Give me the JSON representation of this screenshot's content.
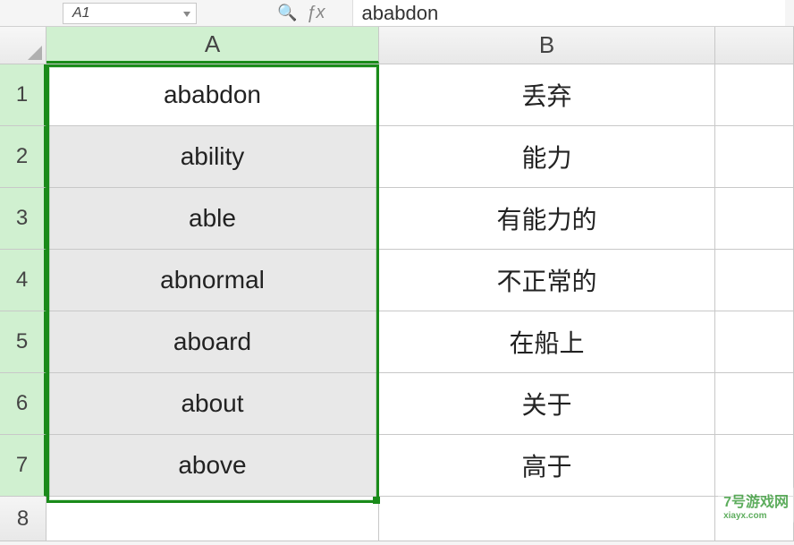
{
  "topbar": {
    "cell_reference": "A1",
    "formula_input_value": "ababdon"
  },
  "columns": [
    {
      "label": "A",
      "selected": true
    },
    {
      "label": "B",
      "selected": false
    }
  ],
  "rows": [
    {
      "num": "1",
      "a": "ababdon",
      "b": "丢弃",
      "active": true,
      "selected": true
    },
    {
      "num": "2",
      "a": "ability",
      "b": "能力",
      "active": false,
      "selected": true
    },
    {
      "num": "3",
      "a": "able",
      "b": "有能力的",
      "active": false,
      "selected": true
    },
    {
      "num": "4",
      "a": "abnormal",
      "b": "不正常的",
      "active": false,
      "selected": true
    },
    {
      "num": "5",
      "a": "aboard",
      "b": "在船上",
      "active": false,
      "selected": true
    },
    {
      "num": "6",
      "a": "about",
      "b": "关于",
      "active": false,
      "selected": true
    },
    {
      "num": "7",
      "a": "above",
      "b": "高于",
      "active": false,
      "selected": true
    },
    {
      "num": "8",
      "a": "",
      "b": "",
      "active": false,
      "selected": false
    }
  ],
  "watermark": {
    "text": "7号游戏网",
    "url": "xiayx.com"
  }
}
